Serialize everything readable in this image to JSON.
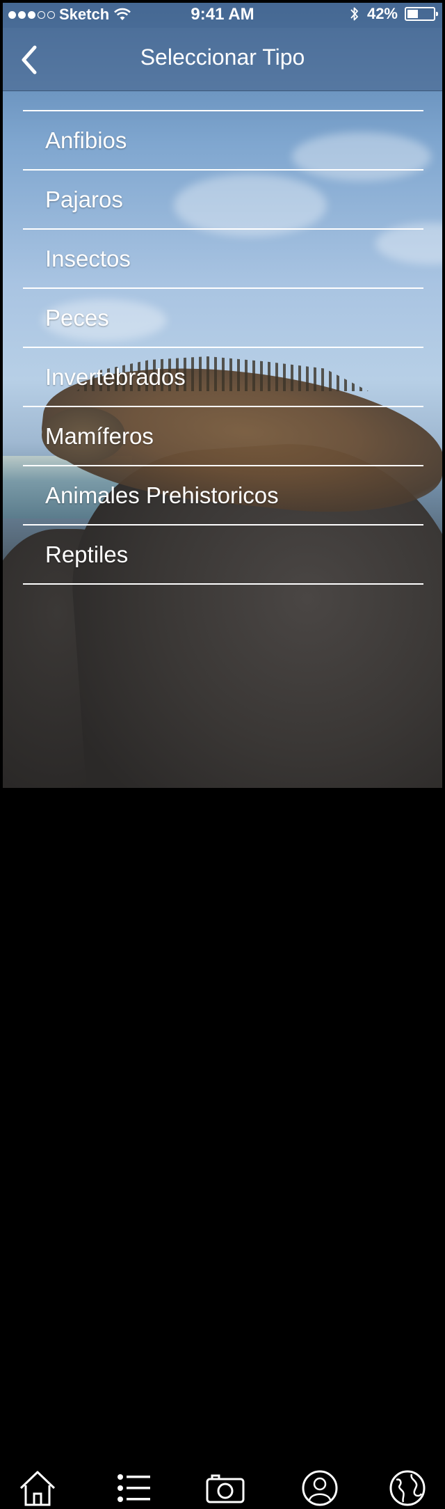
{
  "status_bar": {
    "carrier": "Sketch",
    "time": "9:41 AM",
    "battery": "42%",
    "battery_level": 0.42,
    "signal_bars_filled": 3,
    "signal_bars_total": 5
  },
  "navbar": {
    "title": "Seleccionar Tipo",
    "back_icon": "chevron-left-icon"
  },
  "types": [
    {
      "label": "Anfibios"
    },
    {
      "label": "Pajaros"
    },
    {
      "label": "Insectos"
    },
    {
      "label": "Peces"
    },
    {
      "label": "Invertebrados"
    },
    {
      "label": "Mamíferos"
    },
    {
      "label": "Animales Prehistoricos"
    },
    {
      "label": "Reptiles"
    }
  ],
  "tab_bar": [
    {
      "icon": "home-icon"
    },
    {
      "icon": "list-icon"
    },
    {
      "icon": "camera-icon"
    },
    {
      "icon": "profile-icon"
    },
    {
      "icon": "globe-icon"
    }
  ],
  "colors": {
    "text": "#ffffff",
    "navbar": "#46648c"
  }
}
